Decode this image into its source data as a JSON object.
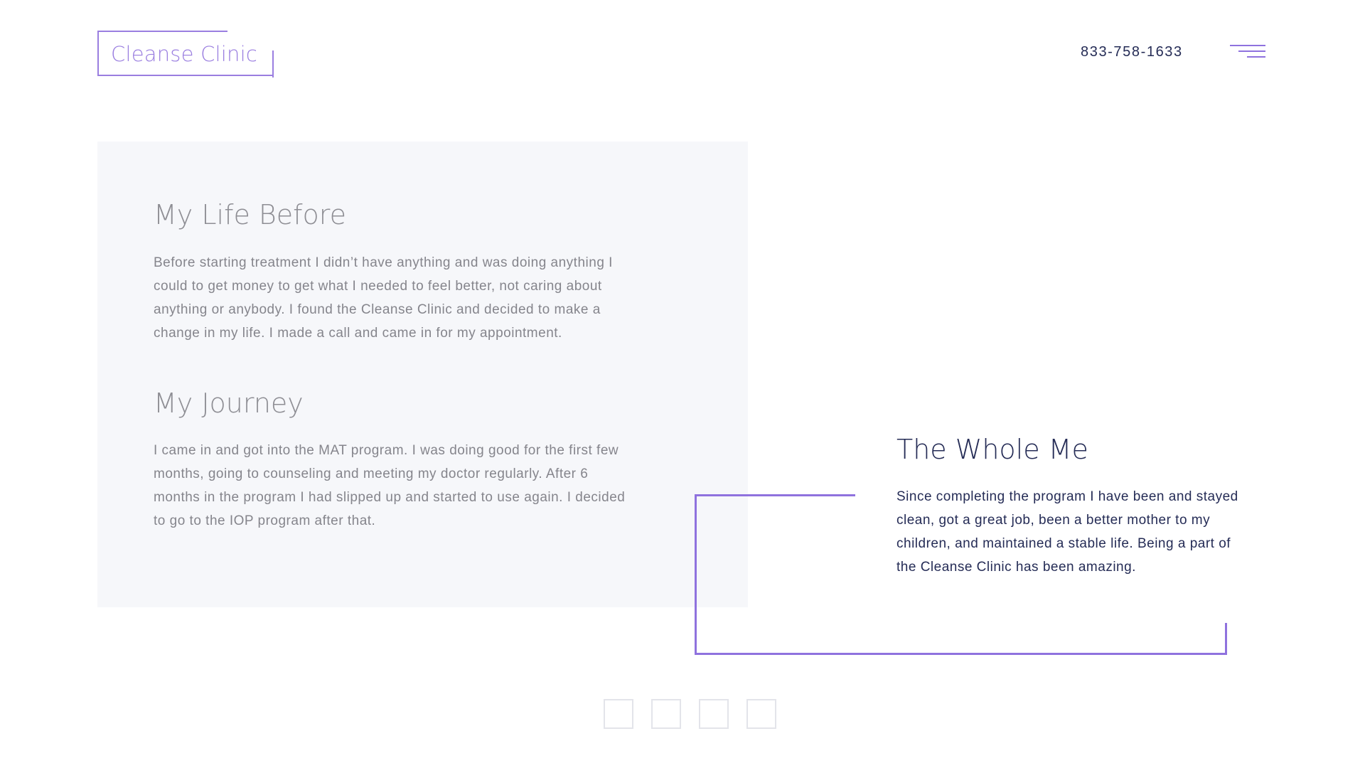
{
  "header": {
    "logo_text": "Cleanse Clinic",
    "phone": "833-758-1633",
    "menu_icon": "hamburger-menu-icon"
  },
  "story": {
    "before": {
      "title": "My Life Before",
      "body": "Before starting treatment I didn’t have anything and was doing anything I could to get money to get what I needed to feel better, not caring about anything or anybody. I found the Cleanse Clinic and decided to make a change in my life. I made a call and came in for my appointment."
    },
    "journey": {
      "title": "My Journey",
      "body": "I came in and got into the MAT program. I was doing good for the first few months, going to counseling and meeting my doctor regularly. After 6 months in the program I had slipped up and started to use again. I decided to go to the IOP program after that."
    },
    "whole_me": {
      "title": "The Whole Me",
      "body": "Since completing the program I have been and stayed clean, got a great job, been a better mother to my children, and maintained a stable life. Being a part of the Cleanse Clinic has been amazing."
    }
  },
  "pagination": {
    "count": 4
  },
  "colors": {
    "accent": "#9a7ee0",
    "navy": "#252c56",
    "muted_text": "#85858c",
    "panel_bg": "#f6f7fa",
    "pager_border": "#e3e4ea"
  }
}
